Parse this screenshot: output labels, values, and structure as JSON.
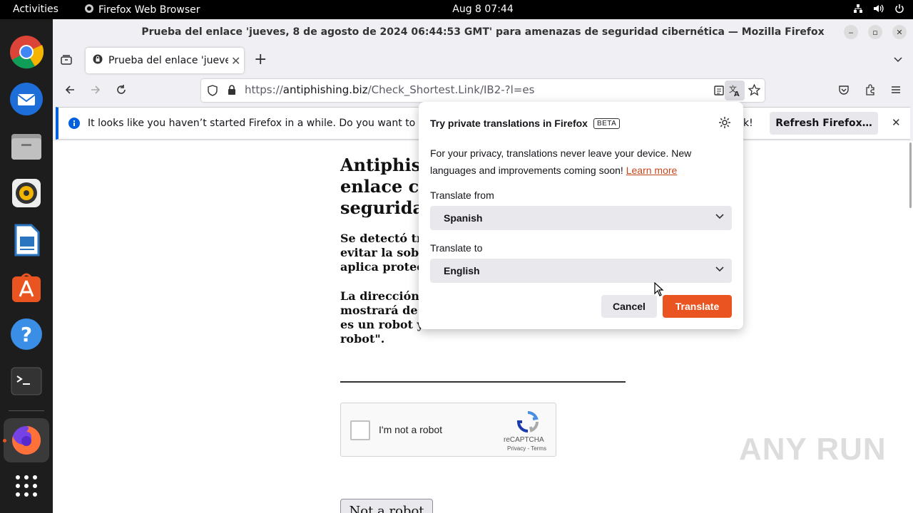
{
  "topbar": {
    "activities": "Activities",
    "app_name": "Firefox Web Browser",
    "clock": "Aug 8  07:44",
    "tray_icons": [
      "network-icon",
      "volume-icon",
      "power-icon"
    ]
  },
  "dock": {
    "apps": [
      "chrome-icon",
      "thunderbird-icon",
      "files-icon",
      "rhythmbox-icon",
      "writer-icon",
      "app-center-icon",
      "help-icon",
      "terminal-icon",
      "firefox-icon",
      "app-grid-icon"
    ],
    "accent": "#e95420"
  },
  "window": {
    "title": "Prueba del enlace 'jueves, 8 de agosto de 2024 06:44:53 GMT' para amenazas de seguridad cibernética — Mozilla Firefox"
  },
  "tab": {
    "title": "Prueba del enlace 'jueves",
    "close": "✕",
    "new_tab": "+"
  },
  "urlbar": {
    "prefix": "https://",
    "domain": "antiphishing.biz",
    "path": "/Check_Shortest.Link/IB2-?l=es"
  },
  "infobar": {
    "message": "It looks like you haven’t started Firefox in a while. Do you want to clean",
    "message_end": "k!",
    "refresh_button": "Refresh Firefox…",
    "close": "✕"
  },
  "page": {
    "heading": "Antiphis enlace c seguridad",
    "heading_lines": [
      "Antiphis",
      "enlace c",
      "seguridad"
    ],
    "para1_lines": [
      "Se detectó tr",
      "evitar la sob",
      "aplica protec"
    ],
    "para2_lines": [
      "La dirección",
      "mostrará de",
      "es un robot y",
      "robot\"."
    ],
    "captcha_label": "I'm not a robot",
    "captcha_brand": "reCAPTCHA",
    "captcha_terms": "Privacy - Terms",
    "button": "Not a robot"
  },
  "translation_panel": {
    "title": "Try private translations in Firefox",
    "beta": "BETA",
    "description": "For your privacy, translations never leave your device. New languages and improvements coming soon!",
    "learn_more": "Learn more",
    "from_label": "Translate from",
    "from_value": "Spanish",
    "to_label": "Translate to",
    "to_value": "English",
    "cancel": "Cancel",
    "translate": "Translate"
  },
  "watermark": "ANY RUN"
}
